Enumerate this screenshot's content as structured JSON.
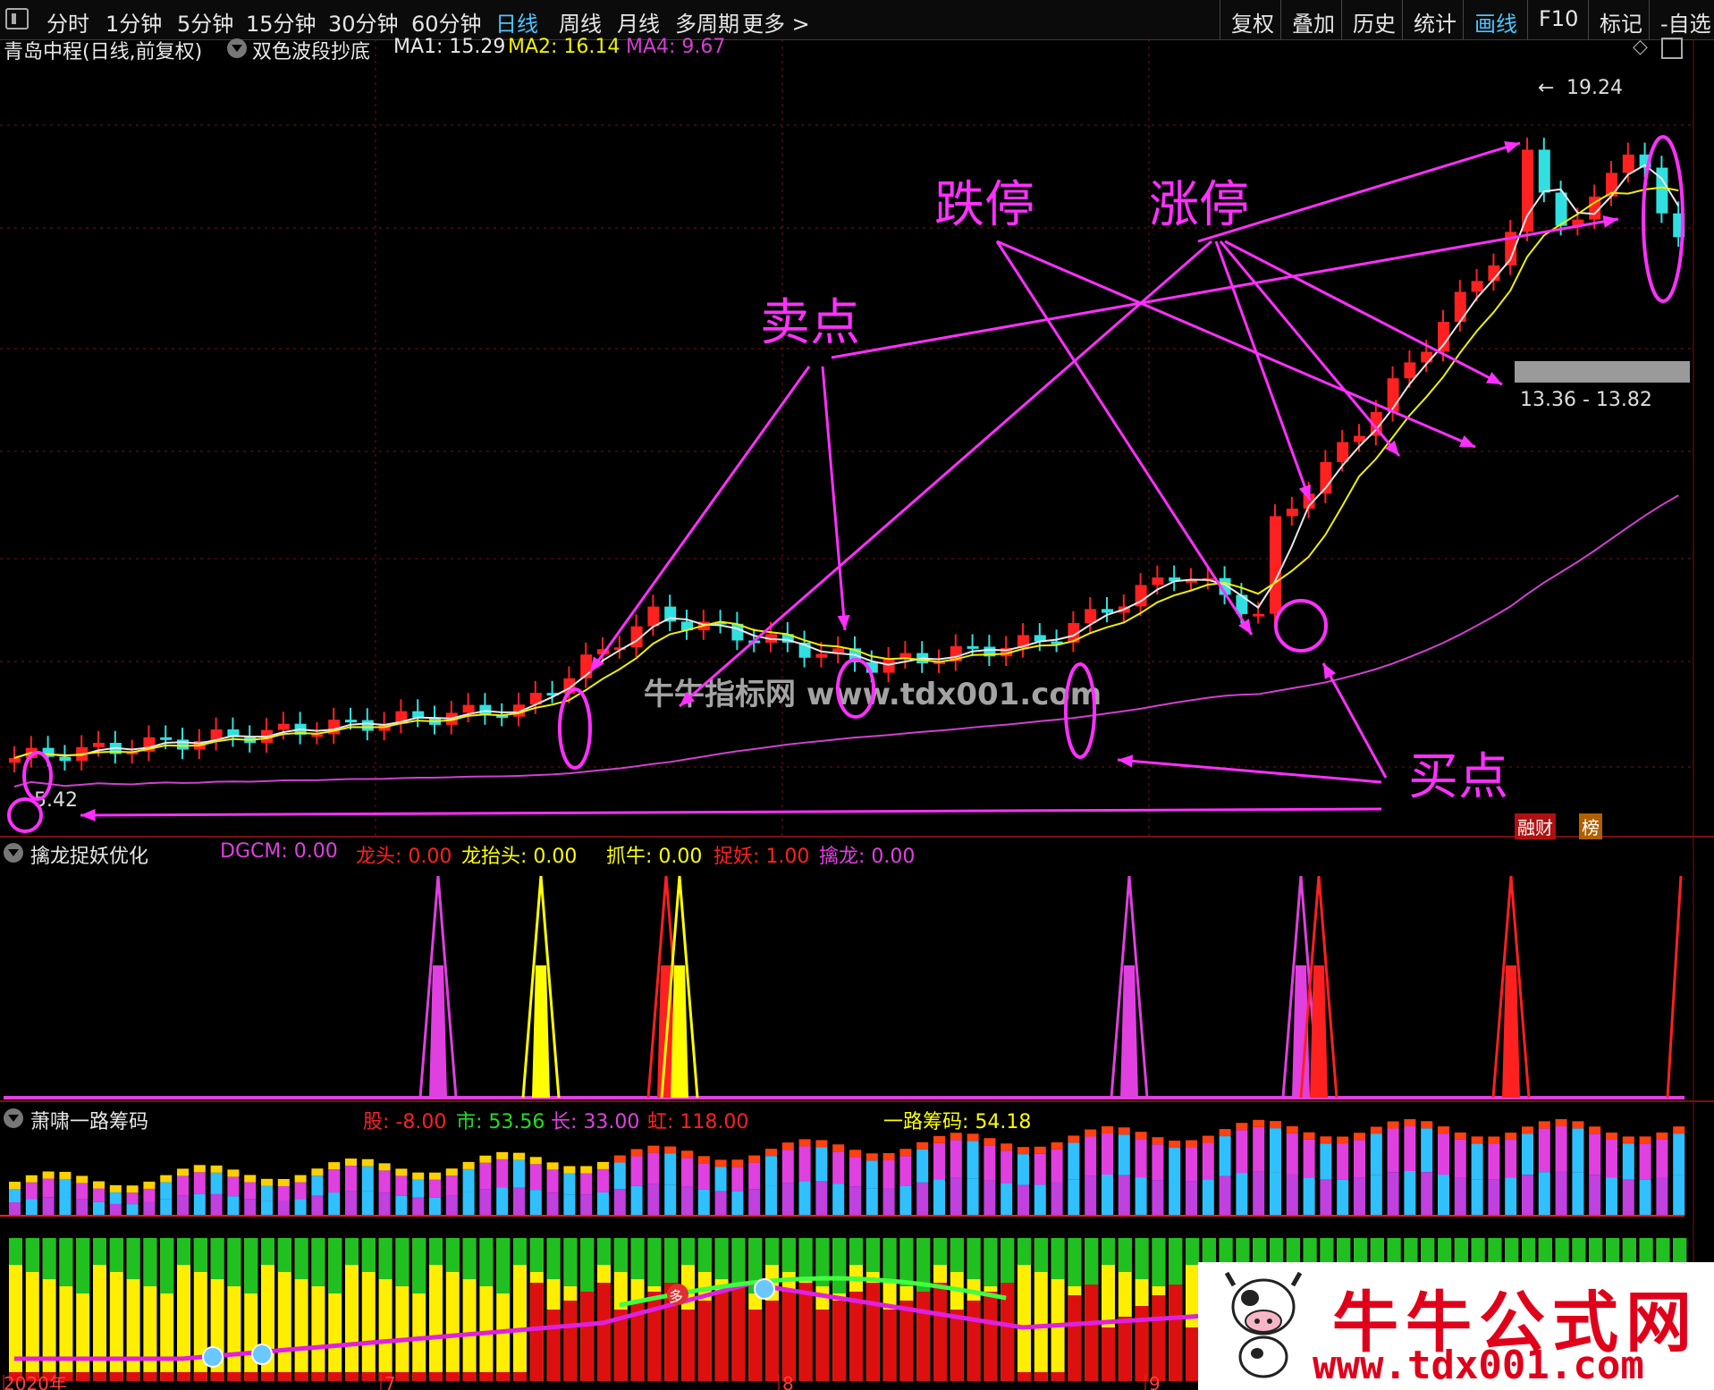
{
  "toolbar": {
    "left_items": [
      "分时",
      "1分钟",
      "5分钟",
      "15分钟",
      "30分钟",
      "60分钟",
      "日线",
      "周线",
      "月线",
      "多周期",
      "更多 >"
    ],
    "active_left": "日线",
    "right_items": [
      "复权",
      "叠加",
      "历史",
      "统计",
      "画线",
      "F10",
      "标记",
      "-自选"
    ],
    "active_right": "画线"
  },
  "main_pane": {
    "stock": "青岛中程(日线,前复权)",
    "indicator": "双色波段抄底",
    "ma1": "MA1: 15.29",
    "ma2": "MA2: 16.14",
    "ma4": "MA4: 9.67",
    "high_label": "19.24",
    "low_label": "5.42",
    "range_label": "13.36 - 13.82",
    "badge_1": "融财",
    "badge_2": "榜",
    "annotations": {
      "sell": "卖点",
      "limit_down": "跌停",
      "limit_up": "涨停",
      "buy": "买点"
    },
    "watermark": "牛牛指标网 www.tdx001.com"
  },
  "pane2": {
    "title": "擒龙捉妖优化",
    "values": [
      {
        "label": "DGCM: 0.00",
        "color": "#e040e0"
      },
      {
        "label": "龙头: 0.00",
        "color": "#ff2020"
      },
      {
        "label": "龙抬头: 0.00",
        "color": "#ffff00"
      },
      {
        "label": "抓牛: 0.00",
        "color": "#ffff00"
      },
      {
        "label": "捉妖: 1.00",
        "color": "#ff2020"
      },
      {
        "label": "擒龙: 0.00",
        "color": "#e040e0"
      }
    ]
  },
  "pane3": {
    "title": "萧啸一路筹码",
    "values": [
      {
        "label": "股: -8.00",
        "color": "#ff2020"
      },
      {
        "label": "市: 53.56",
        "color": "#20e020"
      },
      {
        "label": "长: 33.00",
        "color": "#e040e0"
      },
      {
        "label": "虹: 118.00",
        "color": "#ff2020"
      },
      {
        "label": "一路筹码: 54.18",
        "color": "#ffff00"
      }
    ],
    "marker_text": "多"
  },
  "x_axis": [
    "2020年",
    "7",
    "8",
    "9"
  ],
  "footer_watermark": {
    "title": "牛牛公式网",
    "url": "www.tdx001.com"
  },
  "colors": {
    "up": "#ff2020",
    "down": "#30e0e0",
    "ma1": "#e8e8e8",
    "ma2": "#f0f000",
    "ma4": "#d040d0",
    "annotation": "#ff30ff"
  }
}
